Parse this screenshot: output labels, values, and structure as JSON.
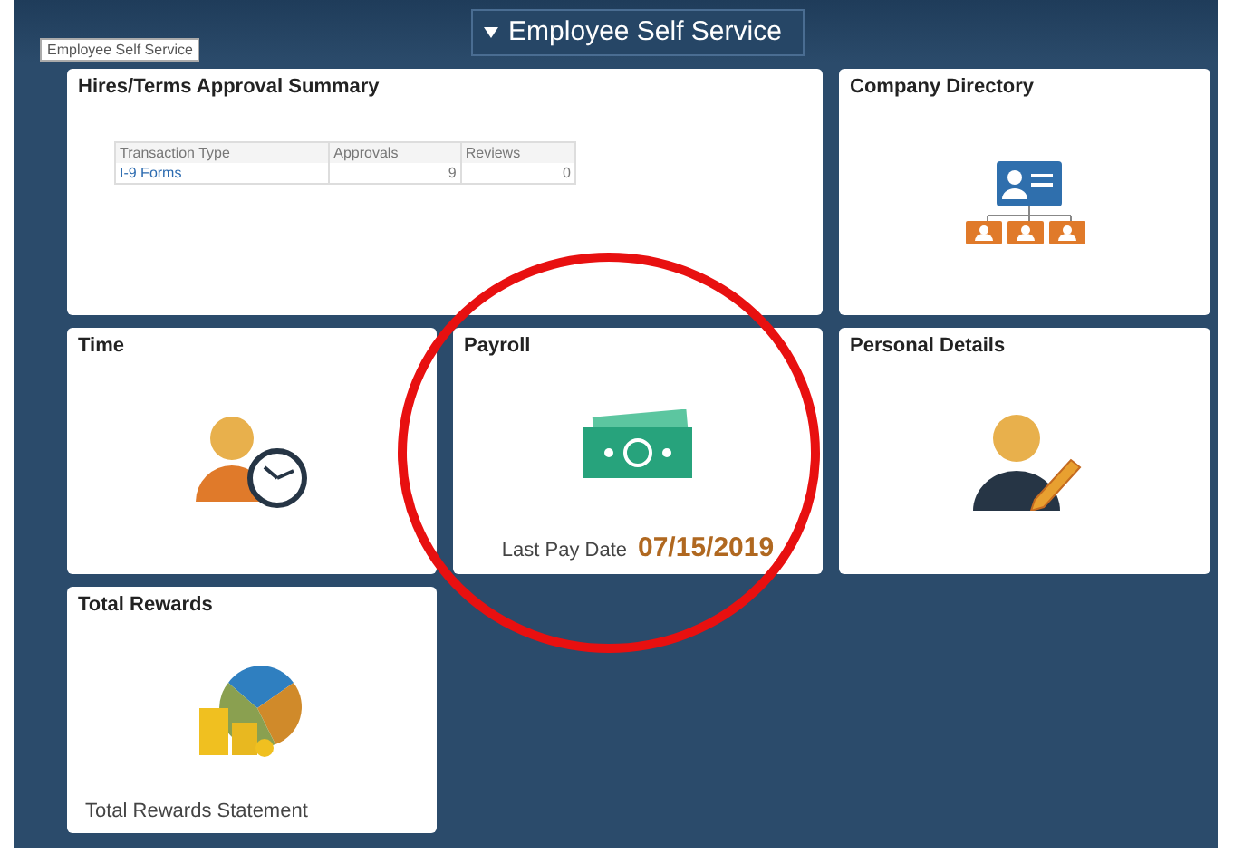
{
  "header": {
    "title": "Employee Self Service",
    "tooltip": "Employee Self Service"
  },
  "tiles": [
    {
      "kind": "table",
      "title": "Hires/Terms Approval Summary",
      "table": {
        "columns": [
          "Transaction Type",
          "Approvals",
          "Reviews"
        ],
        "rows": [
          [
            "I-9 Forms",
            "9",
            "0"
          ]
        ]
      }
    },
    {
      "kind": "directory",
      "title": "Company Directory"
    },
    {
      "kind": "time",
      "title": "Time"
    },
    {
      "kind": "payroll",
      "title": "Payroll",
      "footer_label": "Last Pay Date",
      "footer_value": "07/15/2019"
    },
    {
      "kind": "personal",
      "title": "Personal Details"
    },
    {
      "kind": "rewards",
      "title": "Total Rewards",
      "footer_label": "Total Rewards Statement"
    }
  ],
  "highlight_circle": true
}
